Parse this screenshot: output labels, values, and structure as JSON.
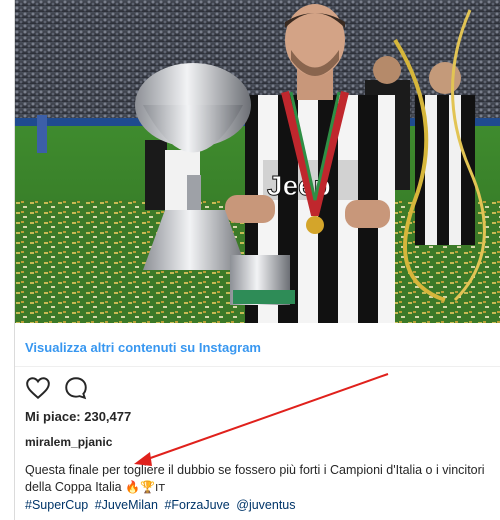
{
  "post": {
    "view_more_label": "Visualizza altri contenuti su Instagram",
    "likes_label": "Mi piace: 230,477",
    "username": "miralem_pjanic",
    "caption_text": "Questa finale per togliere il dubbio se fossero più forti i Campioni d'Italia o i vincitori della Coppa Italia",
    "caption_emoji": "🔥🏆ıт",
    "hashtags": [
      "#SuperCup",
      "#JuveMilan",
      "#ForzaJuve",
      "@juventus"
    ],
    "jersey_text": "Jeep"
  },
  "icons": {
    "like": "heart-icon",
    "comment": "comment-bubble-icon"
  },
  "colors": {
    "link_blue": "#3897f0",
    "hashtag_blue": "#003569",
    "annotation_red": "#e0211c",
    "pitch_green": "#3f8b2e"
  }
}
